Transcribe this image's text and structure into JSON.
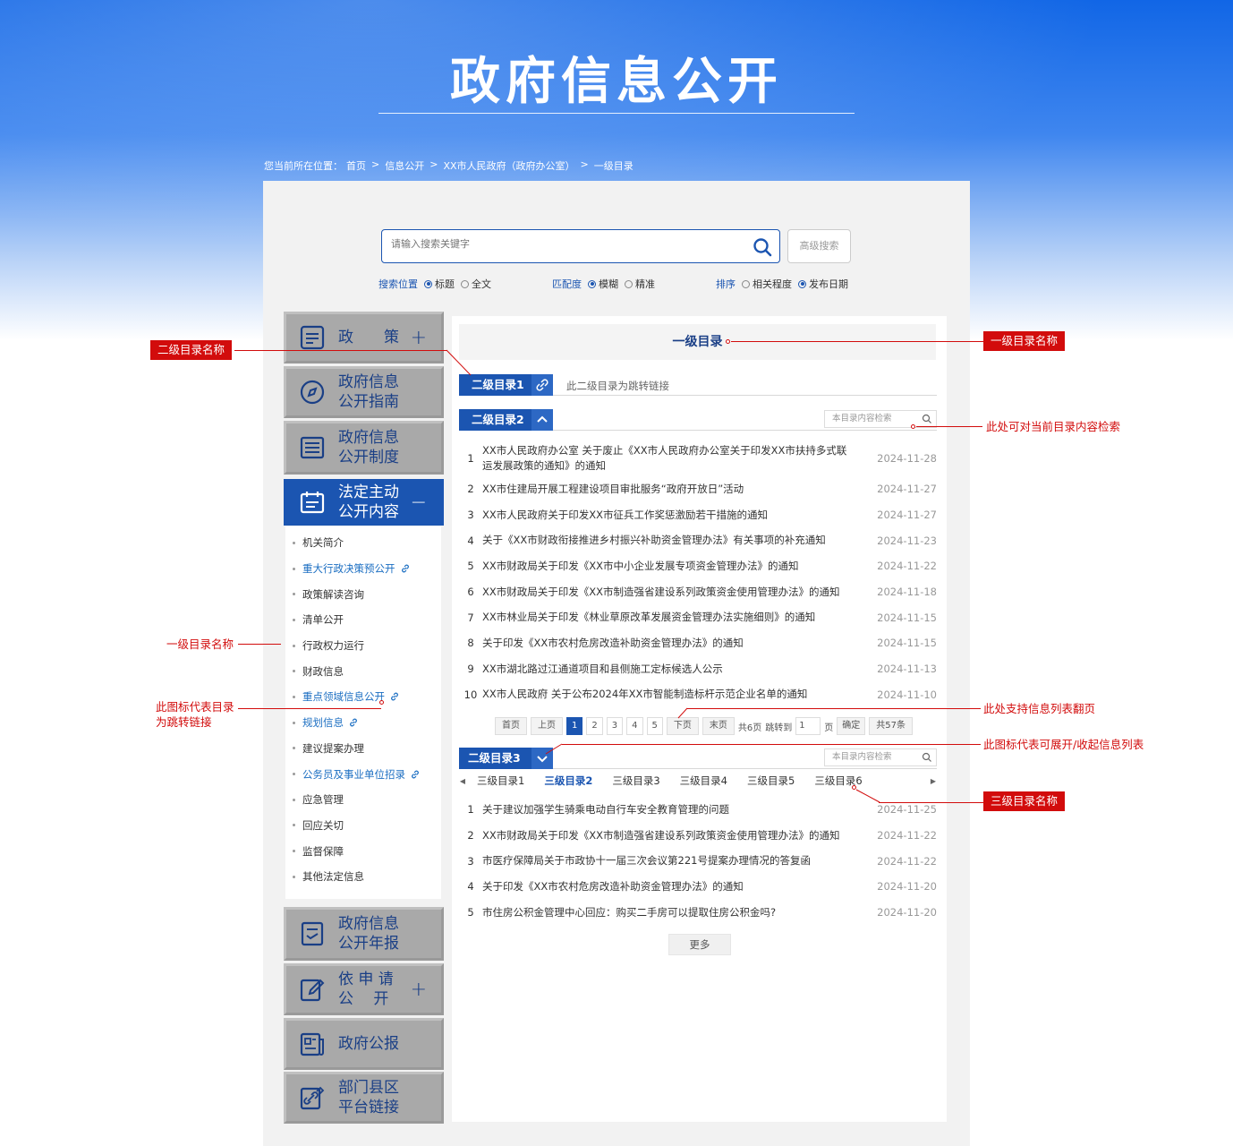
{
  "hero": {
    "title": "政府信息公开"
  },
  "breadcrumb": {
    "prefix": "您当前所在位置：",
    "items": [
      "首页",
      "信息公开",
      "XX市人民政府（政府办公室）",
      "一级目录"
    ],
    "sep": ">"
  },
  "search": {
    "placeholder": "请输入搜索关键字",
    "advanced_label": "高级搜索",
    "position": {
      "label": "搜索位置",
      "options": [
        "标题",
        "全文"
      ],
      "selected": "标题"
    },
    "match": {
      "label": "匹配度",
      "options": [
        "模糊",
        "精准"
      ],
      "selected": "模糊"
    },
    "sort": {
      "label": "排序",
      "options": [
        "相关程度",
        "发布日期"
      ],
      "selected": "发布日期"
    }
  },
  "sidebar": {
    "items": [
      {
        "label": "政　　策",
        "icon": "document-icon",
        "toggle": "+"
      },
      {
        "label": "政府信息\n公开指南",
        "icon": "compass-icon"
      },
      {
        "label": "政府信息\n公开制度",
        "icon": "list-icon"
      },
      {
        "label": "法定主动\n公开内容",
        "icon": "calendar-icon",
        "toggle": "−",
        "active": true
      },
      {
        "label": "政府信息\n公开年报",
        "icon": "report-icon"
      },
      {
        "label": "依 申 请\n公　 开",
        "icon": "edit-icon",
        "toggle": "+"
      },
      {
        "label": "政府公报",
        "icon": "newspaper-icon"
      },
      {
        "label": "部门县区\n平台链接",
        "icon": "link-edit-icon"
      }
    ],
    "sub_items": [
      {
        "label": "机关简介",
        "link": false
      },
      {
        "label": "重大行政决策预公开",
        "link": true
      },
      {
        "label": "政策解读咨询",
        "link": false
      },
      {
        "label": "清单公开",
        "link": false
      },
      {
        "label": "行政权力运行",
        "link": false
      },
      {
        "label": "财政信息",
        "link": false
      },
      {
        "label": "重点领域信息公开",
        "link": true
      },
      {
        "label": "规划信息",
        "link": true
      },
      {
        "label": "建议提案办理",
        "link": false
      },
      {
        "label": "公务员及事业单位招录",
        "link": true
      },
      {
        "label": "应急管理",
        "link": false
      },
      {
        "label": "回应关切",
        "link": false
      },
      {
        "label": "监督保障",
        "link": false
      },
      {
        "label": "其他法定信息",
        "link": false
      }
    ]
  },
  "content": {
    "level1_title": "一级目录",
    "sec1": {
      "label": "二级目录1",
      "note": "此二级目录为跳转链接"
    },
    "sec2": {
      "label": "二级目录2",
      "search_placeholder": "本目录内容检索",
      "rows": [
        {
          "n": "1",
          "title": "XX市人民政府办公室 关于废止《XX市人民政府办公室关于印发XX市扶持多式联运发展政策的通知》的通知",
          "date": "2024-11-28"
        },
        {
          "n": "2",
          "title": "XX市住建局开展工程建设项目审批服务“政府开放日”活动",
          "date": "2024-11-27"
        },
        {
          "n": "3",
          "title": "XX市人民政府关于印发XX市征兵工作奖惩激励若干措施的通知",
          "date": "2024-11-27"
        },
        {
          "n": "4",
          "title": "关于《XX市财政衔接推进乡村振兴补助资金管理办法》有关事项的补充通知",
          "date": "2024-11-23"
        },
        {
          "n": "5",
          "title": "XX市财政局关于印发《XX市中小企业发展专项资金管理办法》的通知",
          "date": "2024-11-22"
        },
        {
          "n": "6",
          "title": "XX市财政局关于印发《XX市制造强省建设系列政策资金使用管理办法》的通知",
          "date": "2024-11-18"
        },
        {
          "n": "7",
          "title": "XX市林业局关于印发《林业草原改革发展资金管理办法实施细则》的通知",
          "date": "2024-11-15"
        },
        {
          "n": "8",
          "title": "关于印发《XX市农村危房改造补助资金管理办法》的通知",
          "date": "2024-11-15"
        },
        {
          "n": "9",
          "title": "XX市湖北路过江通道项目和县侧施工定标候选人公示",
          "date": "2024-11-13"
        },
        {
          "n": "10",
          "title": "XX市人民政府 关于公布2024年XX市智能制造标杆示范企业名单的通知",
          "date": "2024-11-10"
        }
      ],
      "pager": {
        "first": "首页",
        "prev": "上页",
        "pages": [
          "1",
          "2",
          "3",
          "4",
          "5"
        ],
        "current": "1",
        "next": "下页",
        "last": "末页",
        "total_pages": "共6页",
        "jump_label": "跳转到",
        "jump_value": "1",
        "page_unit": "页",
        "confirm": "确定",
        "total_items": "共57条"
      }
    },
    "sec3": {
      "label": "二级目录3",
      "search_placeholder": "本目录内容检索",
      "tabs": [
        "三级目录1",
        "三级目录2",
        "三级目录3",
        "三级目录4",
        "三级目录5",
        "三级目录6"
      ],
      "current_tab": "三级目录2",
      "rows": [
        {
          "n": "1",
          "title": "关于建议加强学生骑乘电动自行车安全教育管理的问题",
          "date": "2024-11-25"
        },
        {
          "n": "2",
          "title": "XX市财政局关于印发《XX市制造强省建设系列政策资金使用管理办法》的通知",
          "date": "2024-11-22"
        },
        {
          "n": "3",
          "title": "市医疗保障局关于市政协十一届三次会议第221号提案办理情况的答复函",
          "date": "2024-11-22"
        },
        {
          "n": "4",
          "title": "关于印发《XX市农村危房改造补助资金管理办法》的通知",
          "date": "2024-11-20"
        },
        {
          "n": "5",
          "title": "市住房公积金管理中心回应：购买二手房可以提取住房公积金吗?",
          "date": "2024-11-20"
        }
      ],
      "more_label": "更多"
    }
  },
  "annotations": {
    "a1": "二级目录名称",
    "a2": "一级目录名称",
    "a3": "一级目录名称",
    "a4": "此处可对当前目录内容检索",
    "a5": "此图标代表目录\n为跳转链接",
    "a6": "此处支持信息列表翻页",
    "a7": "此图标代表可展开/收起信息列表",
    "a8": "三级目录名称"
  },
  "colors": {
    "primary": "#1b55b1",
    "annotation": "#d20c0c",
    "sidebar_gray": "#a9a9a9",
    "heading_blue": "#1a3f86"
  }
}
